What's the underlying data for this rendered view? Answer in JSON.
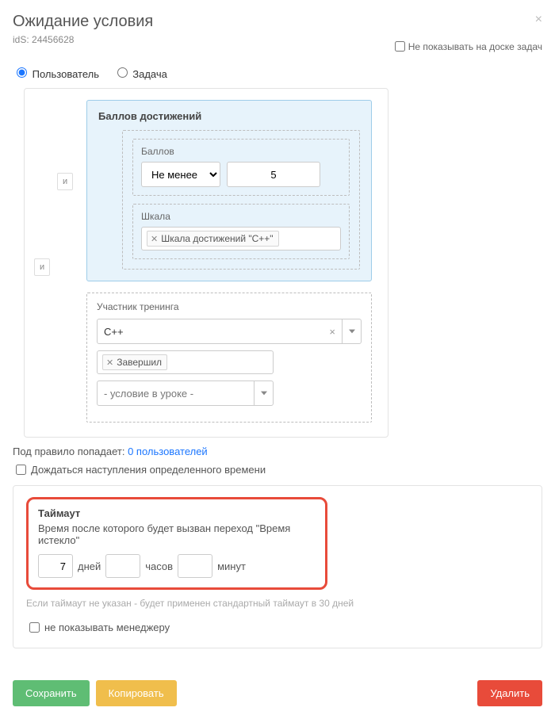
{
  "header": {
    "title": "Ожидание условия",
    "id_prefix": "idS:",
    "id_value": "24456628"
  },
  "top": {
    "hide_on_board_label": "Не показывать на доске задач"
  },
  "radios": {
    "user": "Пользователь",
    "task": "Задача"
  },
  "logic": {
    "and": "и"
  },
  "achievement": {
    "title": "Баллов достижений",
    "points_label": "Баллов",
    "compare_options": [
      "Не менее"
    ],
    "compare_selected": "Не менее",
    "points_value": "5",
    "scale_label": "Шкала",
    "scale_tag": "Шкала достижений \"C++\""
  },
  "training": {
    "title": "Участник тренинга",
    "course": "C++",
    "status_tag": "Завершил",
    "lesson_placeholder": "- условие в уроке -"
  },
  "rule_count": {
    "prefix": "Под правило попадает:",
    "link": "0 пользователей"
  },
  "wait_time_checkbox": "Дождаться наступления определенного времени",
  "timeout": {
    "title": "Таймаут",
    "desc": "Время после которого будет вызван переход \"Время истекло\"",
    "days_value": "7",
    "days_label": "дней",
    "hours_value": "",
    "hours_label": "часов",
    "minutes_value": "",
    "minutes_label": "минут",
    "hint": "Если таймаут не указан - будет применен стандартный таймаут в 30 дней",
    "hide_manager": "не показывать менеджеру"
  },
  "buttons": {
    "save": "Сохранить",
    "copy": "Копировать",
    "delete": "Удалить"
  }
}
